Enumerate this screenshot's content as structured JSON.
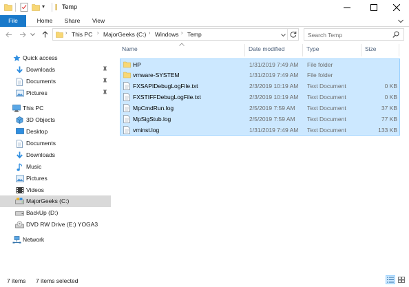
{
  "window": {
    "title": "Temp",
    "minimize_icon": "minimize-icon",
    "maximize_icon": "maximize-icon",
    "close_icon": "close-icon"
  },
  "ribbon": {
    "tabs": [
      {
        "label": "File"
      },
      {
        "label": "Home"
      },
      {
        "label": "Share"
      },
      {
        "label": "View"
      }
    ]
  },
  "address": {
    "crumbs": [
      "This PC",
      "MajorGeeks (C:)",
      "Windows",
      "Temp"
    ]
  },
  "search": {
    "placeholder": "Search Temp"
  },
  "nav": {
    "items": [
      {
        "label": "Quick access",
        "icon": "star-icon",
        "indent": 0,
        "pinned": false,
        "selected": false
      },
      {
        "label": "Downloads",
        "icon": "download-arrow-icon",
        "indent": 1,
        "pinned": true,
        "selected": false
      },
      {
        "label": "Documents",
        "icon": "document-icon",
        "indent": 1,
        "pinned": true,
        "selected": false
      },
      {
        "label": "Pictures",
        "icon": "pictures-icon",
        "indent": 1,
        "pinned": true,
        "selected": false
      },
      {
        "label": "This PC",
        "icon": "computer-icon",
        "indent": 0,
        "pinned": false,
        "selected": false
      },
      {
        "label": "3D Objects",
        "icon": "cube-icon",
        "indent": 1,
        "pinned": false,
        "selected": false
      },
      {
        "label": "Desktop",
        "icon": "desktop-icon",
        "indent": 1,
        "pinned": false,
        "selected": false
      },
      {
        "label": "Documents",
        "icon": "document-icon",
        "indent": 1,
        "pinned": false,
        "selected": false
      },
      {
        "label": "Downloads",
        "icon": "download-arrow-icon",
        "indent": 1,
        "pinned": false,
        "selected": false
      },
      {
        "label": "Music",
        "icon": "music-note-icon",
        "indent": 1,
        "pinned": false,
        "selected": false
      },
      {
        "label": "Pictures",
        "icon": "pictures-icon",
        "indent": 1,
        "pinned": false,
        "selected": false
      },
      {
        "label": "Videos",
        "icon": "video-icon",
        "indent": 1,
        "pinned": false,
        "selected": false
      },
      {
        "label": "MajorGeeks (C:)",
        "icon": "drive-icon",
        "indent": 1,
        "pinned": false,
        "selected": true
      },
      {
        "label": "BackUp (D:)",
        "icon": "drive-icon",
        "indent": 1,
        "pinned": false,
        "selected": false
      },
      {
        "label": "DVD RW Drive (E:) YOGA3",
        "icon": "disc-drive-icon",
        "indent": 1,
        "pinned": false,
        "selected": false
      },
      {
        "label": "Network",
        "icon": "network-icon",
        "indent": 0,
        "pinned": false,
        "selected": false
      }
    ]
  },
  "columns": {
    "name": "Name",
    "date": "Date modified",
    "type": "Type",
    "size": "Size"
  },
  "files": [
    {
      "name": "HP",
      "date": "1/31/2019 7:49 AM",
      "type": "File folder",
      "size": "",
      "icon": "folder-icon"
    },
    {
      "name": "vmware-SYSTEM",
      "date": "1/31/2019 7:49 AM",
      "type": "File folder",
      "size": "",
      "icon": "folder-icon"
    },
    {
      "name": "FXSAPIDebugLogFile.txt",
      "date": "2/3/2019 10:19 AM",
      "type": "Text Document",
      "size": "0 KB",
      "icon": "text-file-icon"
    },
    {
      "name": "FXSTIFFDebugLogFile.txt",
      "date": "2/3/2019 10:19 AM",
      "type": "Text Document",
      "size": "0 KB",
      "icon": "text-file-icon"
    },
    {
      "name": "MpCmdRun.log",
      "date": "2/5/2019 7:59 AM",
      "type": "Text Document",
      "size": "37 KB",
      "icon": "text-file-icon"
    },
    {
      "name": "MpSigStub.log",
      "date": "2/5/2019 7:59 AM",
      "type": "Text Document",
      "size": "77 KB",
      "icon": "text-file-icon"
    },
    {
      "name": "vminst.log",
      "date": "1/31/2019 7:49 AM",
      "type": "Text Document",
      "size": "133 KB",
      "icon": "text-file-icon"
    }
  ],
  "status": {
    "item_count": "7 items",
    "selected_count": "7 items selected"
  },
  "colors": {
    "accent": "#1979ca",
    "selection_fill": "#cce8ff",
    "selection_border": "#99d1ff",
    "folder": "#f8d775"
  }
}
